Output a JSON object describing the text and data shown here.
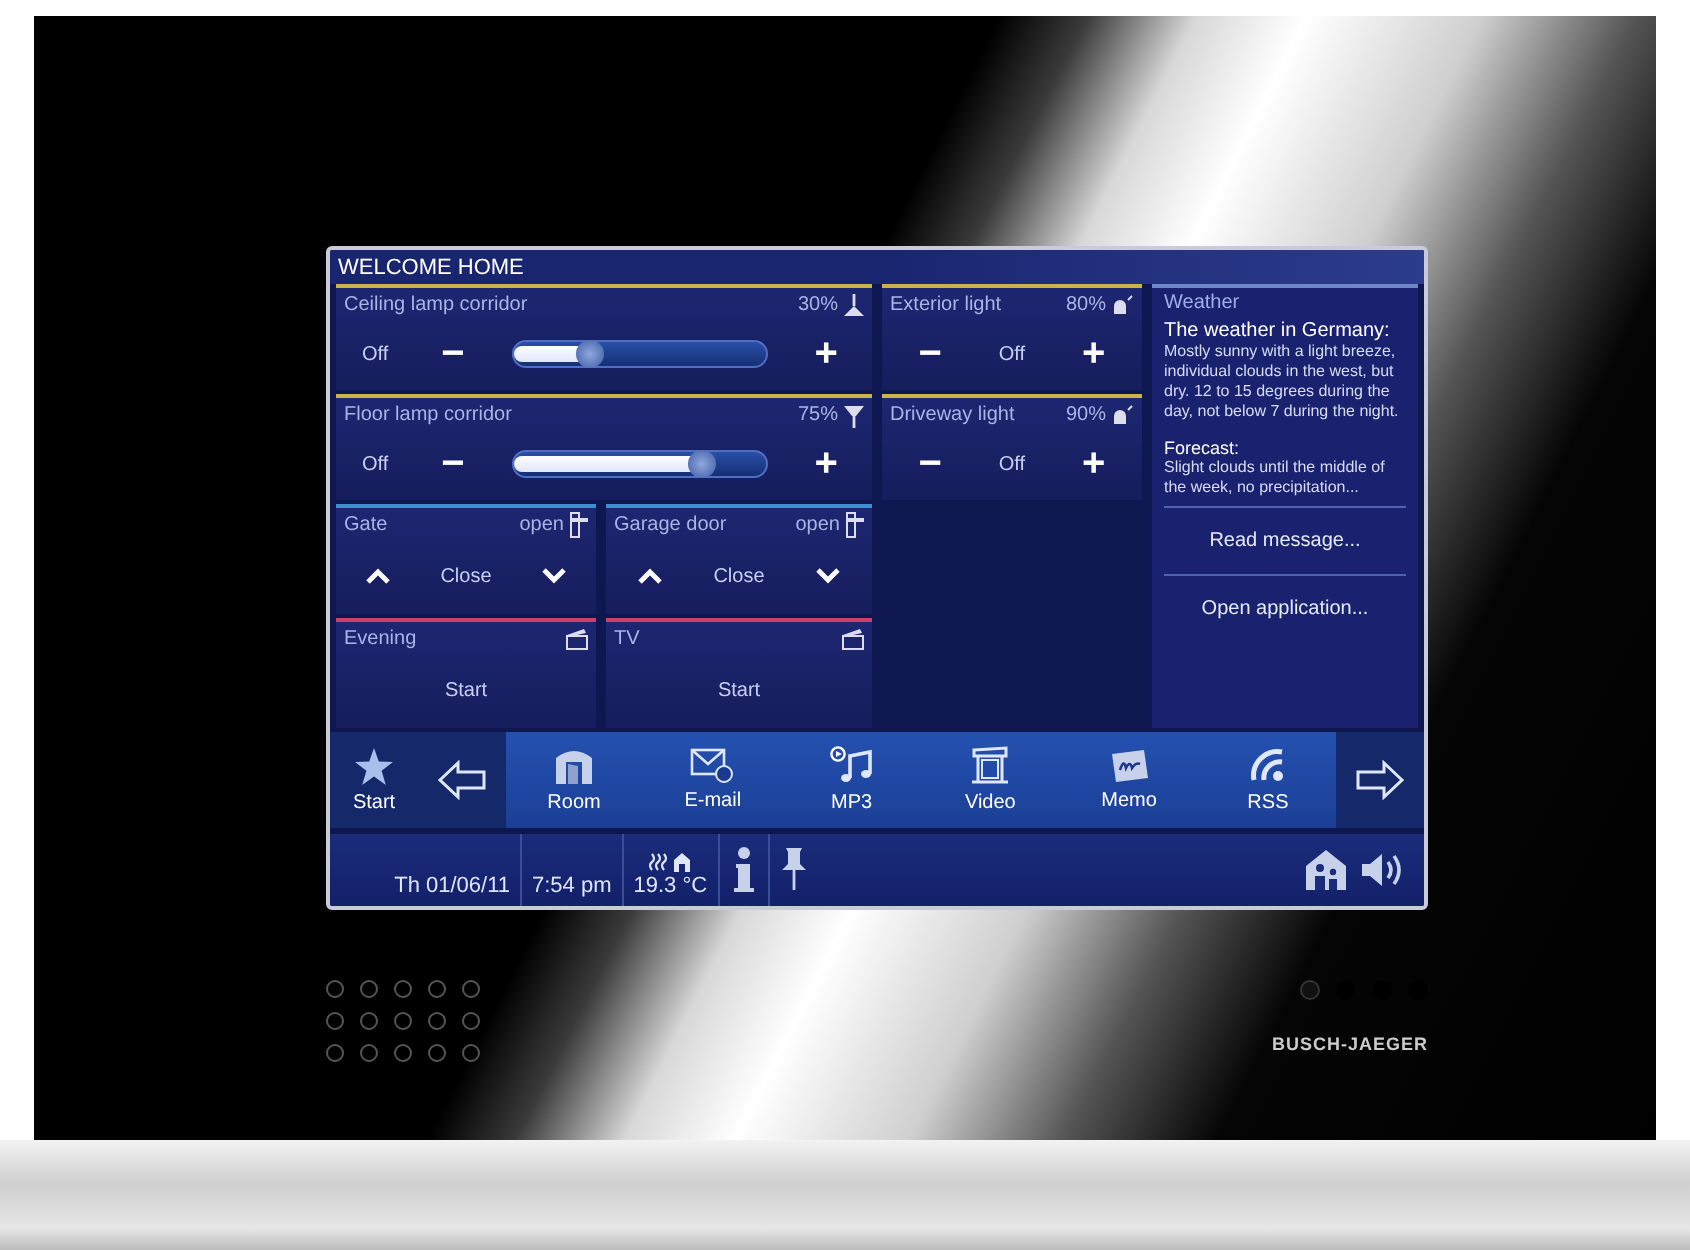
{
  "screen": {
    "title": "WELCOME HOME"
  },
  "dimmers": [
    {
      "name": "Ceiling lamp corridor",
      "reading": "30%",
      "level": 0.3,
      "off_label": "Off",
      "minus": "−",
      "plus": "+"
    },
    {
      "name": "Floor lamp corridor",
      "reading": "75%",
      "level": 0.75,
      "off_label": "Off",
      "minus": "−",
      "plus": "+"
    }
  ],
  "switches": [
    {
      "name": "Exterior light",
      "reading": "80%",
      "state": "Off",
      "minus": "−",
      "plus": "+"
    },
    {
      "name": "Driveway light",
      "reading": "90%",
      "state": "Off",
      "minus": "−",
      "plus": "+"
    }
  ],
  "blinds": [
    {
      "name": "Gate",
      "status": "open",
      "action": "Close"
    },
    {
      "name": "Garage door",
      "status": "open",
      "action": "Close"
    }
  ],
  "scenes": [
    {
      "name": "Evening",
      "action": "Start"
    },
    {
      "name": "TV",
      "action": "Start"
    }
  ],
  "weather": {
    "title": "Weather",
    "heading": "The weather in Germany:",
    "text": "Mostly sunny with a light breeze, individual clouds in the west, but dry. 12 to 15 degrees during the day, not below 7 during the night.",
    "forecast_heading": "Forecast:",
    "forecast_text": "Slight clouds until the middle of the week, no precipitation...",
    "buttons": [
      "Read message...",
      "Open application..."
    ]
  },
  "nav": {
    "start": "Start",
    "items": [
      {
        "kind": "room",
        "label": "Room"
      },
      {
        "kind": "email",
        "label": "E-mail"
      },
      {
        "kind": "mp3",
        "label": "MP3"
      },
      {
        "kind": "video",
        "label": "Video"
      },
      {
        "kind": "memo",
        "label": "Memo"
      },
      {
        "kind": "rss",
        "label": "RSS"
      }
    ]
  },
  "status_bar": {
    "date": "Th 01/06/11",
    "time": "7:54 pm",
    "temperature": "19.3 °C"
  },
  "device": {
    "brand": "BUSCH-JAEGER"
  }
}
